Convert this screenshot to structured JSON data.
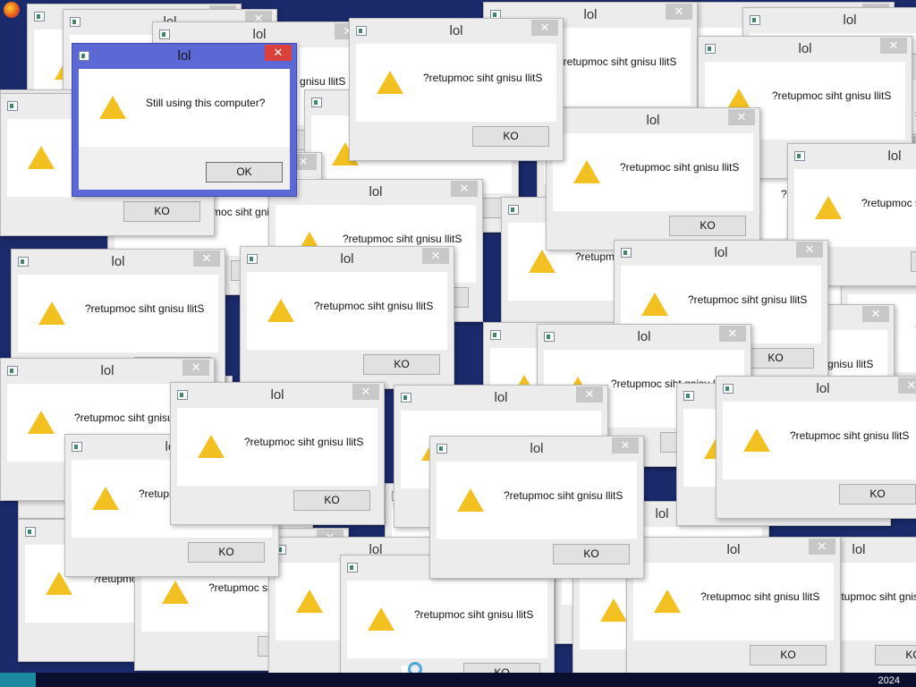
{
  "taskbar": {
    "year": "2024"
  },
  "dialog_main": {
    "title": "lol",
    "message": "Still using this computer?",
    "ok_label": "OK",
    "close_glyph": "✕"
  },
  "dialog_copy": {
    "title": "lol",
    "message": "?retupmoc siht gnisu llitS",
    "ok_label": "KO",
    "close_glyph": "✕"
  },
  "icons": {
    "warning": "warning-icon",
    "window": "app-window-icon",
    "close": "close-icon"
  }
}
